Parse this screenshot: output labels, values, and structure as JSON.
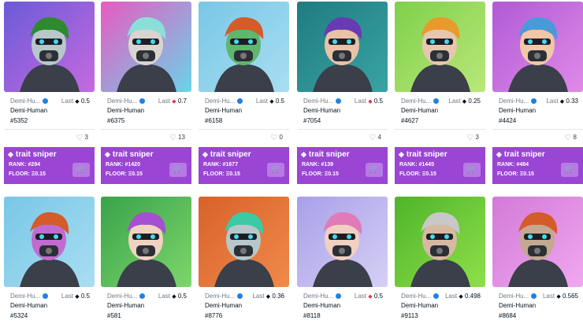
{
  "row1": [
    {
      "collection": "Demi-Hu...",
      "price_label": "Last",
      "price": "0.5",
      "price_eth": "dark",
      "name": "Demi-Human",
      "number": "#5352",
      "likes": "3",
      "rank": "RANK: #294",
      "floor": "FLOOR: Ξ0.15",
      "bg": "#6b5bd8",
      "bg2": "#c56adf",
      "face": "#b8c7c9",
      "hair": "#2d8a2f"
    },
    {
      "collection": "Demi-Hu...",
      "price_label": "Last",
      "price": "0.7",
      "price_eth": "red",
      "name": "Demi-Human",
      "number": "#6375",
      "likes": "13",
      "rank": "RANK: #1420",
      "floor": "FLOOR: Ξ0.15",
      "bg": "#e85ac1",
      "bg2": "#6ad4e8",
      "face": "#d9d4cf",
      "hair": "#8ae0d8"
    },
    {
      "collection": "Demi-Hu...",
      "price_label": "Last",
      "price": "0.5",
      "price_eth": "dark",
      "name": "Demi-Human",
      "number": "#6158",
      "likes": "0",
      "rank": "RANK: #1677",
      "floor": "FLOOR: Ξ0.15",
      "bg": "#78c7e6",
      "bg2": "#a9def2",
      "face": "#5fb66d",
      "hair": "#d45b2a"
    },
    {
      "collection": "Demi-Hu...",
      "price_label": "Last",
      "price": "0.5",
      "price_eth": "red",
      "name": "Demi-Human",
      "number": "#7054",
      "likes": "4",
      "rank": "RANK: #139",
      "floor": "FLOOR: Ξ0.15",
      "bg": "#1f7c80",
      "bg2": "#3aa3a3",
      "face": "#e8c2a6",
      "hair": "#6a3ab5"
    },
    {
      "collection": "Demi-Hu...",
      "price_label": "Last",
      "price": "0.25",
      "price_eth": "dark",
      "name": "Demi-Human",
      "number": "#4627",
      "likes": "3",
      "rank": "RANK: #1445",
      "floor": "FLOOR: Ξ0.15",
      "bg": "#7fd04a",
      "bg2": "#b9e87a",
      "face": "#e7c6b0",
      "hair": "#e89a2c"
    },
    {
      "collection": "Demi-Hu...",
      "price_label": "Last",
      "price": "0.33",
      "price_eth": "dark",
      "name": "Demi-Human",
      "number": "#4424",
      "likes": "8",
      "rank": "RANK: #484",
      "floor": "FLOOR: Ξ0.15",
      "bg": "#b05ad6",
      "bg2": "#e08ae8",
      "face": "#f0c7a8",
      "hair": "#4b9ad8"
    }
  ],
  "row2": [
    {
      "collection": "Demi-Hu...",
      "price_label": "Last",
      "price": "0.5",
      "price_eth": "dark",
      "name": "Demi-Human",
      "number": "#5324",
      "bg": "#78c7e6",
      "bg2": "#a9def2",
      "face": "#c16bd1",
      "hair": "#d45b2a"
    },
    {
      "collection": "Demi-Hu...",
      "price_label": "Last",
      "price": "0.5",
      "price_eth": "dark",
      "name": "Demi-Human",
      "number": "#581",
      "bg": "#3aa34a",
      "bg2": "#7dd66b",
      "face": "#f1d2c0",
      "hair": "#a550d0"
    },
    {
      "collection": "Demi-Hu...",
      "price_label": "Last",
      "price": "0.36",
      "price_eth": "dark",
      "name": "Demi-Human",
      "number": "#8776",
      "bg": "#d9622a",
      "bg2": "#f08a4a",
      "face": "#b8c7c9",
      "hair": "#3cc9a5"
    },
    {
      "collection": "Demi-Hu...",
      "price_label": "Last",
      "price": "0.5",
      "price_eth": "red",
      "name": "Demi-Human",
      "number": "#8118",
      "bg": "#a8a0e8",
      "bg2": "#d6d0f6",
      "face": "#f0d0c0",
      "hair": "#e07ab8"
    },
    {
      "collection": "Demi-Hu...",
      "price_label": "Last",
      "price": "0.498",
      "price_eth": "dark",
      "name": "Demi-Human",
      "number": "#9113",
      "bg": "#4fb42a",
      "bg2": "#8fe04a",
      "face": "#d7b8a0",
      "hair": "#c8c8c8"
    },
    {
      "collection": "Demi-Hu...",
      "price_label": "Last",
      "price": "0.565",
      "price_eth": "dark",
      "name": "Demi-Human",
      "number": "#8684",
      "bg": "#d27ad8",
      "bg2": "#f0a8ef",
      "face": "#c4a890",
      "hair": "#d45b2a"
    }
  ],
  "trait_sniper_label": "trait sniper",
  "icons": {
    "eth": "eth-icon",
    "heart": "heart-icon",
    "cart": "cart-icon",
    "verified": "verified-badge-icon",
    "diamond": "diamond-icon"
  }
}
